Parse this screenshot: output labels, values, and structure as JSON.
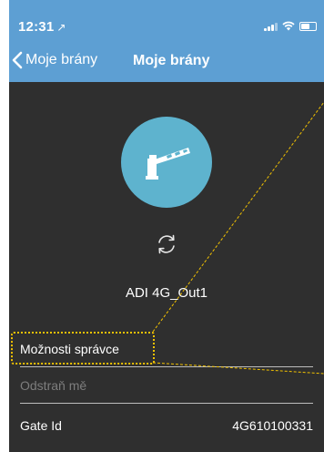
{
  "status_bar": {
    "time": "12:31",
    "location_arrow": "↗",
    "icons": [
      "signal-icon",
      "wifi-icon",
      "battery-icon"
    ]
  },
  "nav": {
    "back_label": "Moje brány",
    "title": "Moje brány"
  },
  "device": {
    "name": "ADI 4G_Out1",
    "icon": "gate-barrier-icon",
    "refresh_icon": "refresh-icon"
  },
  "settings": {
    "admin_options_label": "Možnosti správce",
    "remove_me_label": "Odstraň mě",
    "gate_id_label": "Gate Id",
    "gate_id_value": "4G610100331"
  },
  "colors": {
    "accent": "#5d9fd3",
    "icon_circle": "#5eb3ce",
    "background": "#2f2f2f",
    "highlight": "#f2c200",
    "disabled_text": "#7d7d7d"
  }
}
